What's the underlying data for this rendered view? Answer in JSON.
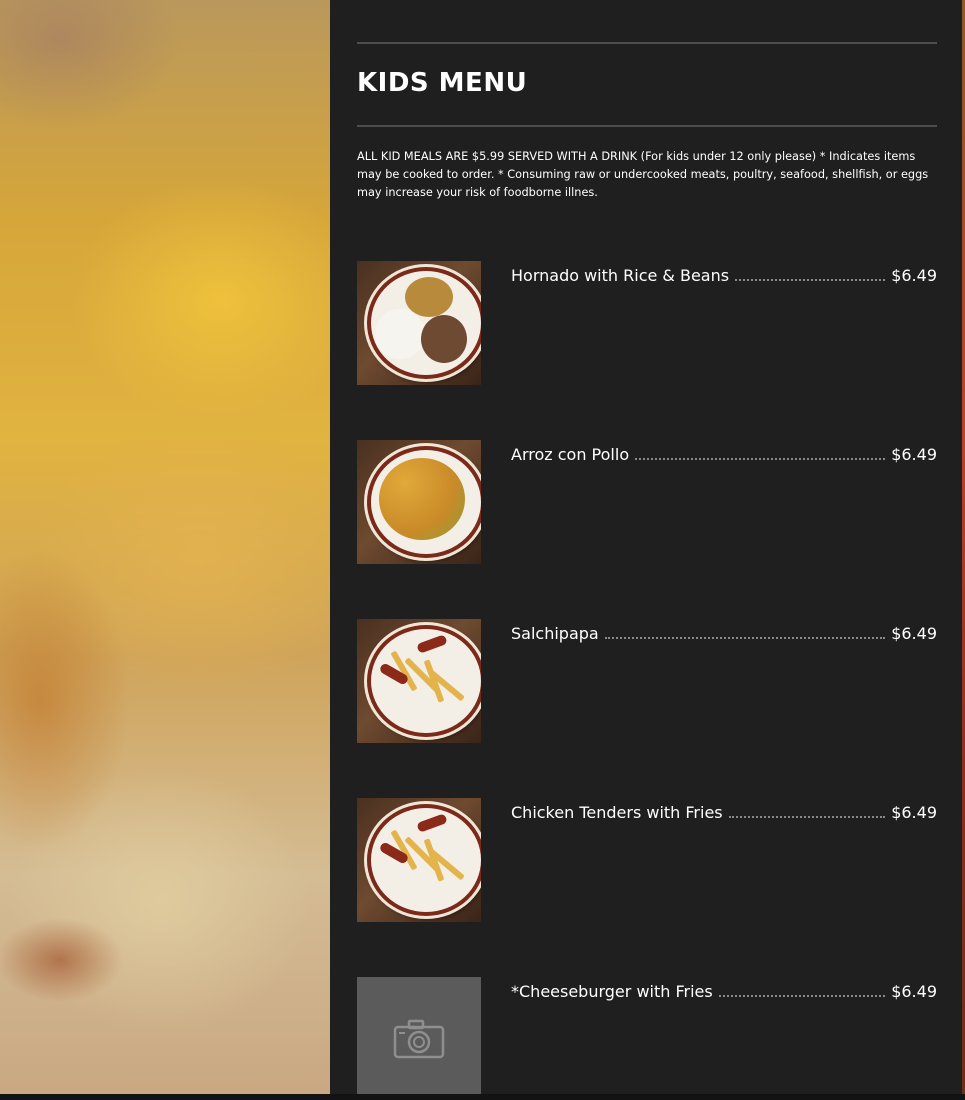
{
  "menu": {
    "title": "KIDS MENU",
    "description": "ALL KID MEALS ARE $5.99 SERVED WITH A DRINK (For kids under 12 only please) * Indicates items may be cooked to order. * Consuming raw or undercooked meats, poultry, seafood, shellfish, or eggs may increase your risk of foodborne illnes.",
    "items": [
      {
        "name": "Hornado with Rice & Beans",
        "price": "$6.49",
        "image": "photo"
      },
      {
        "name": "Arroz con Pollo",
        "price": "$6.49",
        "image": "photo"
      },
      {
        "name": "Salchipapa",
        "price": "$6.49",
        "image": "photo"
      },
      {
        "name": "Chicken Tenders with Fries",
        "price": "$6.49",
        "image": "photo"
      },
      {
        "name": "*Cheeseburger with Fries",
        "price": "$6.49",
        "image": "camera-placeholder-icon"
      }
    ]
  },
  "colors": {
    "panel_background": "#1f1f1f",
    "text": "#ffffff",
    "divider": "#4d4d4d",
    "placeholder": "#5b5b5b"
  }
}
